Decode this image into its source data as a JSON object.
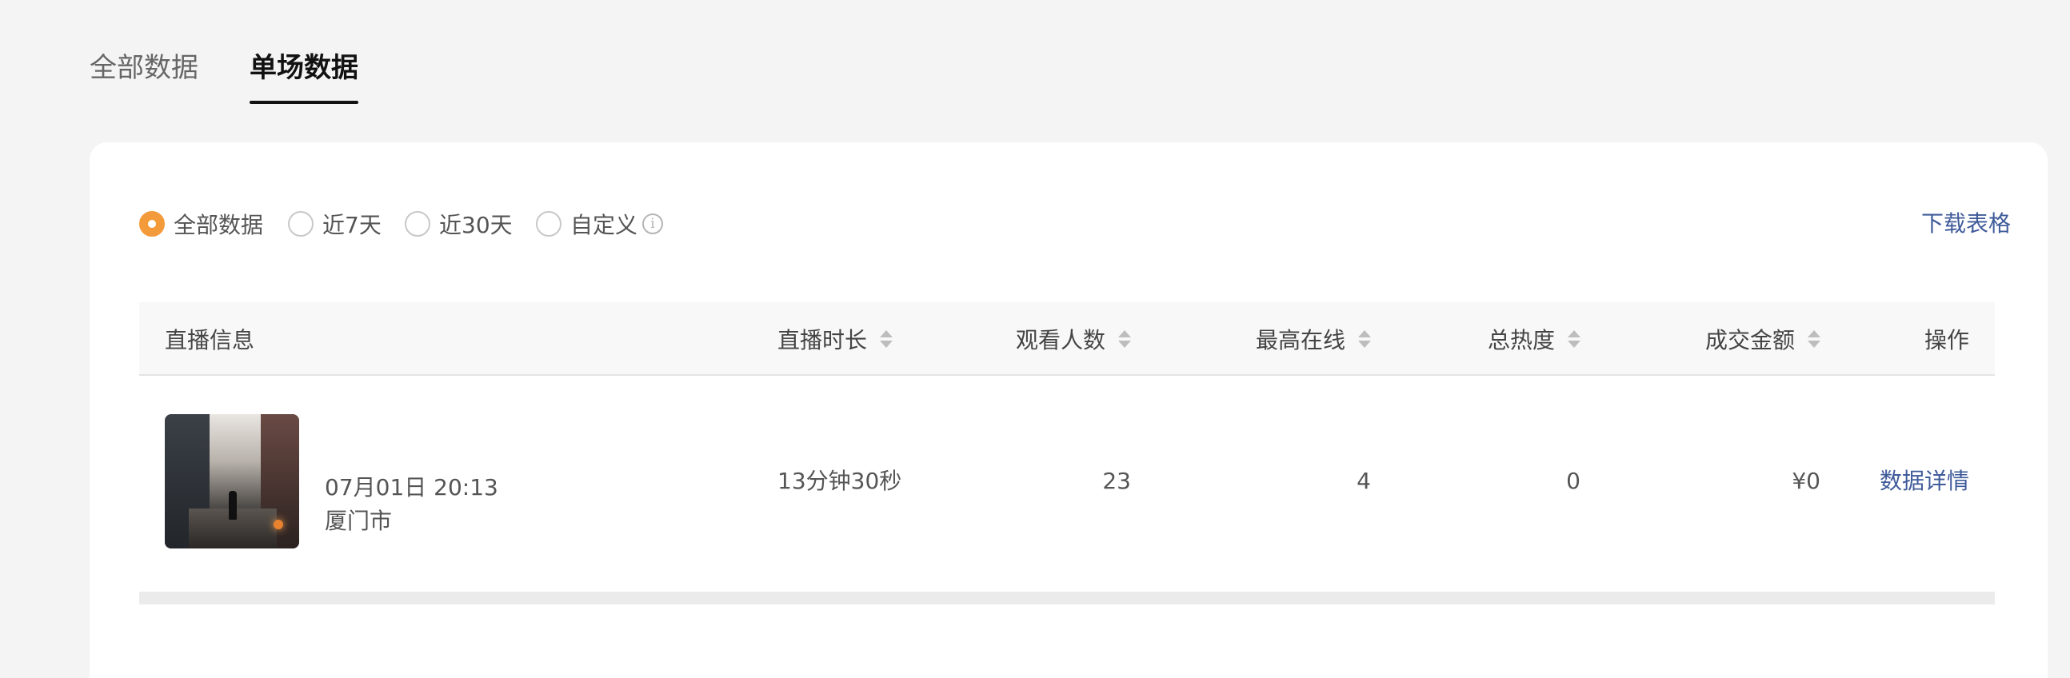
{
  "tabs": [
    {
      "label": "全部数据",
      "active": false
    },
    {
      "label": "单场数据",
      "active": true
    }
  ],
  "filters": {
    "options": [
      {
        "label": "全部数据",
        "selected": true
      },
      {
        "label": "近7天",
        "selected": false
      },
      {
        "label": "近30天",
        "selected": false
      },
      {
        "label": "自定义",
        "selected": false
      }
    ],
    "info_icon": "info-icon",
    "download_label": "下载表格"
  },
  "colors": {
    "accent": "#f39a3a",
    "link": "#3f5b9a",
    "background": "#f4f4f4"
  },
  "table": {
    "columns": [
      {
        "label": "直播信息",
        "sortable": false
      },
      {
        "label": "直播时长",
        "sortable": true
      },
      {
        "label": "观看人数",
        "sortable": true
      },
      {
        "label": "最高在线",
        "sortable": true
      },
      {
        "label": "总热度",
        "sortable": true
      },
      {
        "label": "成交金额",
        "sortable": true
      },
      {
        "label": "操作",
        "sortable": false
      }
    ],
    "rows": [
      {
        "time": "07月01日 20:13",
        "location": "厦门市",
        "duration": "13分钟30秒",
        "viewers": "23",
        "peak_online": "4",
        "total_heat": "0",
        "sales": "¥0",
        "action": "数据详情"
      }
    ]
  }
}
